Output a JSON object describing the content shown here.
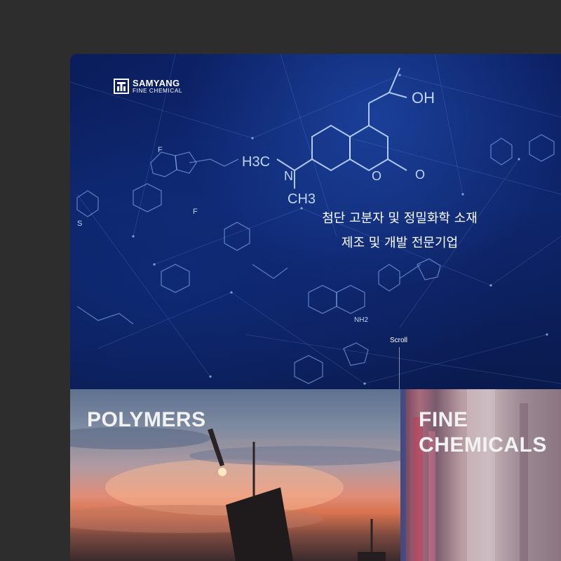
{
  "brand": {
    "name": "SAMYANG",
    "sub": "FINE CHEMICAL"
  },
  "hero": {
    "tagline_line1": "첨단 고분자 및 정밀화학 소재",
    "tagline_line2": "제조 및 개발 전문기업",
    "scroll_label": "Scroll"
  },
  "molecule_labels": {
    "oh": "OH",
    "h3c": "H3C",
    "ch3": "CH3",
    "n": "N",
    "o1": "O",
    "o2": "O",
    "f1": "F",
    "f2": "F",
    "s": "S",
    "nh2": "NH2"
  },
  "panels": [
    {
      "title": "POLYMERS"
    },
    {
      "title": "FINE\nCHEMICALS"
    }
  ],
  "colors": {
    "page_bg": "#2d2d2d",
    "hero_bg": "#0d2466",
    "text": "#ffffff"
  }
}
